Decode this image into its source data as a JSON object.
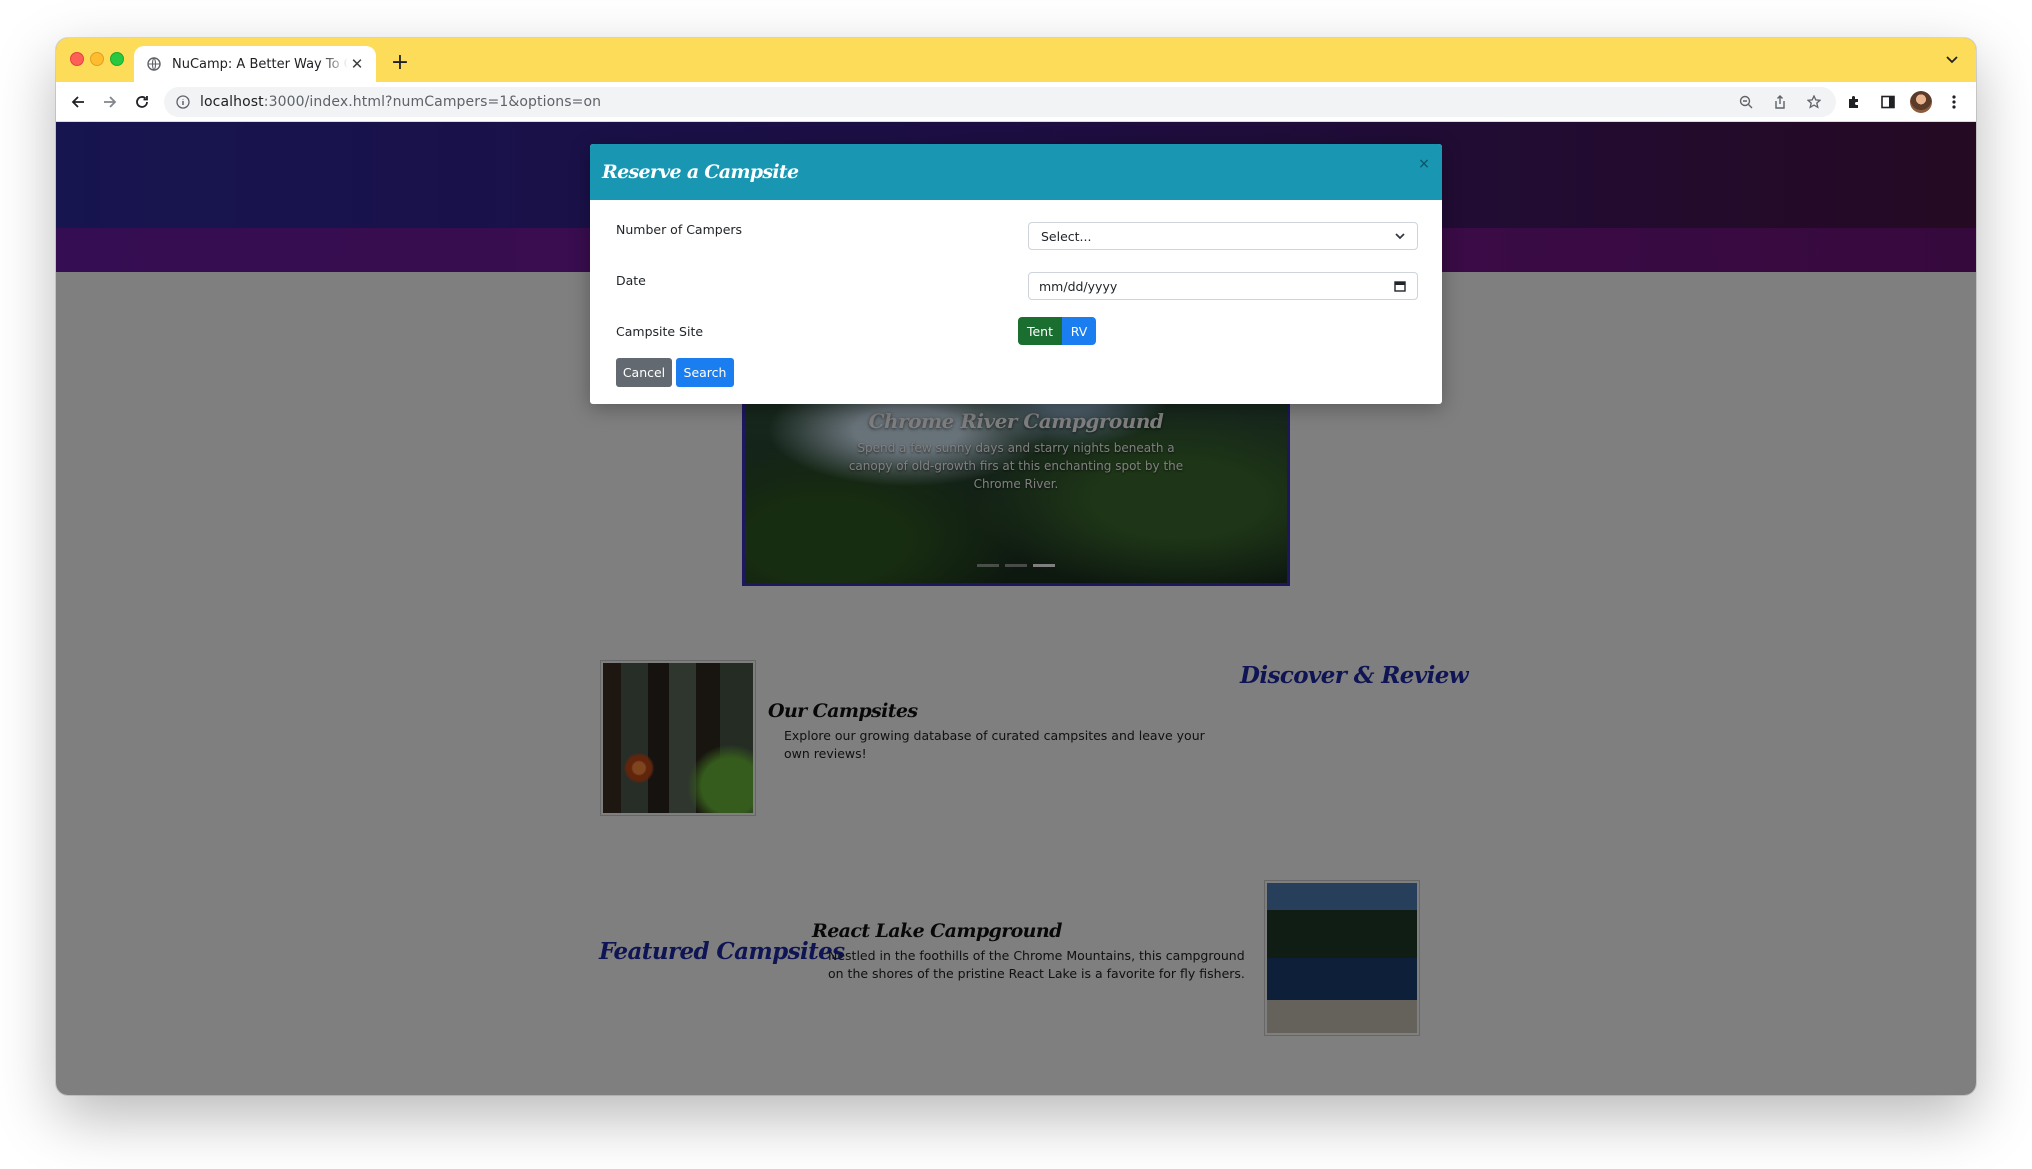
{
  "browser": {
    "tab_title": "NuCamp: A Better Way To Camp",
    "url_host": "localhost",
    "url_rest": ":3000/index.html?numCampers=1&options=on",
    "new_tab_label": "+",
    "close_label": "✕"
  },
  "carousel": {
    "title": "Chrome River Campground",
    "text": "Spend a few sunny days and starry nights beneath a canopy of old-growth firs at this enchanting spot by the Chrome River.",
    "prev": "‹",
    "next": "›"
  },
  "discover": {
    "heading": "Discover & Review",
    "item_title": "Our Campsites",
    "item_text": "Explore our growing database of curated campsites and leave your own reviews!"
  },
  "featured": {
    "heading": "Featured Campsites",
    "item_title": "React Lake Campground",
    "item_text": "Nestled in the foothills of the Chrome Mountains, this campground on the shores of the pristine React Lake is a favorite for fly fishers."
  },
  "modal": {
    "title": "Reserve a Campsite",
    "close": "×",
    "campers_label": "Number of Campers",
    "campers_value": "Select...",
    "date_label": "Date",
    "date_placeholder": "mm/dd/yyyy",
    "site_label": "Campsite Site",
    "site_options": [
      "Tent",
      "RV"
    ],
    "cancel": "Cancel",
    "search": "Search"
  },
  "colors": {
    "chrome_frame": "#fddc59",
    "modal_header": "#1896b2",
    "tent_button": "#1a6f30",
    "primary_button": "#1a7ef0",
    "secondary_button": "#626970",
    "heading_blue": "#1f2aa8"
  },
  "icons": [
    "globe-icon",
    "back-arrow-icon",
    "forward-arrow-icon",
    "reload-icon",
    "info-icon",
    "zoom-icon",
    "share-icon",
    "star-icon",
    "extensions-icon",
    "sidepanel-icon",
    "menu-icon",
    "chevron-down-icon",
    "calendar-icon"
  ]
}
